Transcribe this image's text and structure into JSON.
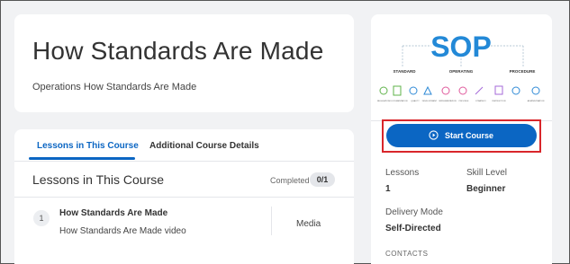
{
  "header": {
    "title": "How Standards Are Made",
    "subtitle": "Operations How Standards Are Made"
  },
  "tabs": [
    {
      "label": "Lessons in This Course",
      "active": true
    },
    {
      "label": "Additional Course Details",
      "active": false
    }
  ],
  "lessons": {
    "title": "Lessons in This Course",
    "completed_label": "Completed",
    "completed_count": "0/1",
    "items": [
      {
        "number": "1",
        "name": "How Standards Are Made",
        "description": "How Standards Are Made video",
        "type": "Media"
      }
    ]
  },
  "sidebar": {
    "image": {
      "heading": "SOP",
      "sections": [
        "STANDARD",
        "OPERATING",
        "PROCEDURE"
      ],
      "icons": [
        "REGULATION",
        "DOCUMENTATION",
        "QUALITY",
        "DEVELOPMENT",
        "IMPLEMENTATION",
        "PROCESS",
        "STRATEGY",
        "INSTRUCTION",
        "ADMINISTRATION"
      ]
    },
    "start_button_label": "Start Course",
    "lessons_label": "Lessons",
    "lessons_value": "1",
    "skill_label": "Skill Level",
    "skill_value": "Beginner",
    "delivery_label": "Delivery Mode",
    "delivery_value": "Self-Directed",
    "contacts_label": "CONTACTS"
  },
  "colors": {
    "accent": "#0b66c3",
    "highlight": "#d9262b",
    "background": "#f1f2f4"
  }
}
